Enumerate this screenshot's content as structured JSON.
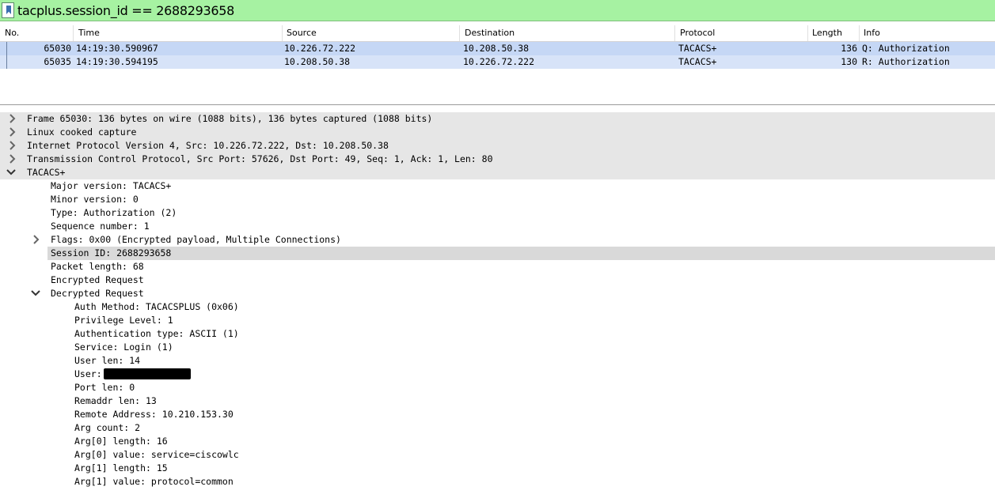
{
  "filter": {
    "text": "tacplus.session_id == 2688293658"
  },
  "packet_list": {
    "columns": [
      "No.",
      "Time",
      "Source",
      "Destination",
      "Protocol",
      "Length",
      "Info"
    ],
    "rows": [
      {
        "no": "65030",
        "time": "14:19:30.590967",
        "source": "10.226.72.222",
        "destination": "10.208.50.38",
        "protocol": "TACACS+",
        "length": "136",
        "info": "Q: Authorization"
      },
      {
        "no": "65035",
        "time": "14:19:30.594195",
        "source": "10.208.50.38",
        "destination": "10.226.72.222",
        "protocol": "TACACS+",
        "length": "130",
        "info": "R: Authorization"
      }
    ]
  },
  "details": {
    "frame": "Frame 65030: 136 bytes on wire (1088 bits), 136 bytes captured (1088 bits)",
    "linux": "Linux cooked capture",
    "ip": "Internet Protocol Version 4, Src: 10.226.72.222, Dst: 10.208.50.38",
    "tcp": "Transmission Control Protocol, Src Port: 57626, Dst Port: 49, Seq: 1, Ack: 1, Len: 80",
    "tacacs": "TACACS+",
    "major": "Major version: TACACS+",
    "minor": "Minor version: 0",
    "type": "Type: Authorization (2)",
    "seq": "Sequence number: 1",
    "flags": "Flags: 0x00 (Encrypted payload, Multiple Connections)",
    "session": "Session ID: 2688293658",
    "plen": "Packet length: 68",
    "enc": "Encrypted Request",
    "dec": "Decrypted Request",
    "auth_method": "Auth Method: TACACSPLUS (0x06)",
    "priv": "Privilege Level: 1",
    "auth_type": "Authentication type: ASCII (1)",
    "service": "Service: Login (1)",
    "user_len": "User len: 14",
    "user": "User:",
    "port_len": "Port len: 0",
    "remaddr_len": "Remaddr len: 13",
    "remote": "Remote Address: 10.210.153.30",
    "arg_count": "Arg count: 2",
    "arg0_len": "Arg[0] length: 16",
    "arg0_val": "Arg[0] value: service=ciscowlc",
    "arg1_len": "Arg[1] length: 15",
    "arg1_val": "Arg[1] value: protocol=common"
  },
  "colors": {
    "filter_bg": "#a6f2a2",
    "selected_row": "#c5d7f5",
    "related_row": "#d7e3f8",
    "tree_highlight": "#e6e6e6",
    "session_highlight": "#d9d9d9"
  },
  "icons": [
    "bookmark-icon",
    "chevron-right-icon",
    "chevron-down-icon"
  ]
}
